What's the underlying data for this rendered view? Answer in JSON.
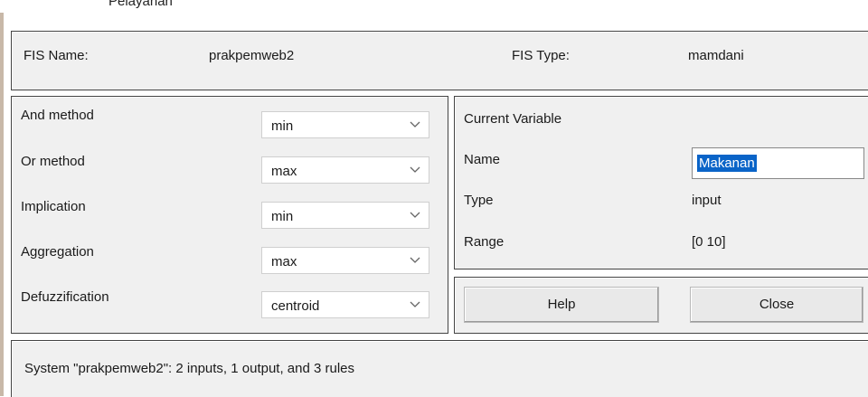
{
  "window_title": "Pelayanan",
  "fis": {
    "name_label": "FIS Name:",
    "name_value": "prakpemweb2",
    "type_label": "FIS Type:",
    "type_value": "mamdani"
  },
  "methods": [
    {
      "label": "And method",
      "value": "min"
    },
    {
      "label": "Or method",
      "value": "max"
    },
    {
      "label": "Implication",
      "value": "min"
    },
    {
      "label": "Aggregation",
      "value": "max"
    },
    {
      "label": "Defuzzification",
      "value": "centroid"
    }
  ],
  "current_variable": {
    "title": "Current Variable",
    "name_label": "Name",
    "name_value": "Makanan",
    "type_label": "Type",
    "type_value": "input",
    "range_label": "Range",
    "range_value": "[0 10]"
  },
  "buttons": {
    "help": "Help",
    "close": "Close"
  },
  "status": "System \"prakpemweb2\": 2 inputs, 1 output, and 3 rules",
  "colors": {
    "panel_bg": "#f0f0f0",
    "selection": "#0a64c8"
  }
}
